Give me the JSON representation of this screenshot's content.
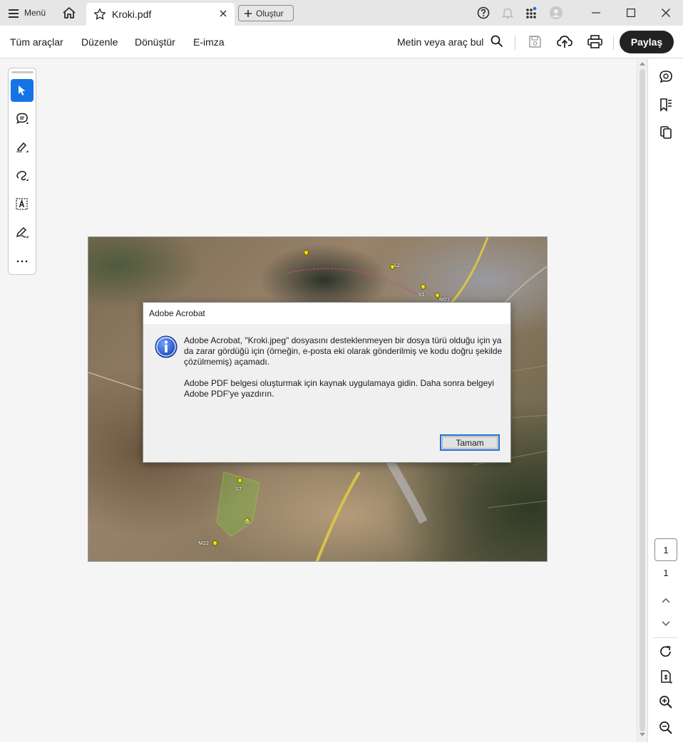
{
  "titlebar": {
    "menu_label": "Menü",
    "tab_title": "Kroki.pdf",
    "create_label": "Oluştur"
  },
  "toolbar": {
    "menus": [
      "Tüm araçlar",
      "Düzenle",
      "Dönüştür",
      "E-imza"
    ],
    "find_label": "Metin veya araç bul",
    "share_label": "Paylaş"
  },
  "right_panel": {
    "current_page": "1",
    "total_pages": "1"
  },
  "document": {
    "map_labels": [
      "S2",
      "S1",
      "NO1",
      "S7",
      "S6",
      "NO2"
    ]
  },
  "dialog": {
    "title": "Adobe Acrobat",
    "message_1": "Adobe Acrobat, \"Kroki.jpeg\" dosyasını desteklenmeyen bir dosya türü olduğu için ya da zarar gördüğü için (örneğin, e-posta eki olarak gönderilmiş ve kodu doğru şekilde çözülmemiş) açamadı.",
    "message_2": "Adobe PDF belgesi oluşturmak için kaynak uygulamaya gidin. Daha sonra belgeyi Adobe PDF'ye yazdırın.",
    "ok_label": "Tamam"
  },
  "colors": {
    "accent": "#1473e6",
    "share_bg": "#222222",
    "titlebar_bg": "#e6e6e6"
  }
}
